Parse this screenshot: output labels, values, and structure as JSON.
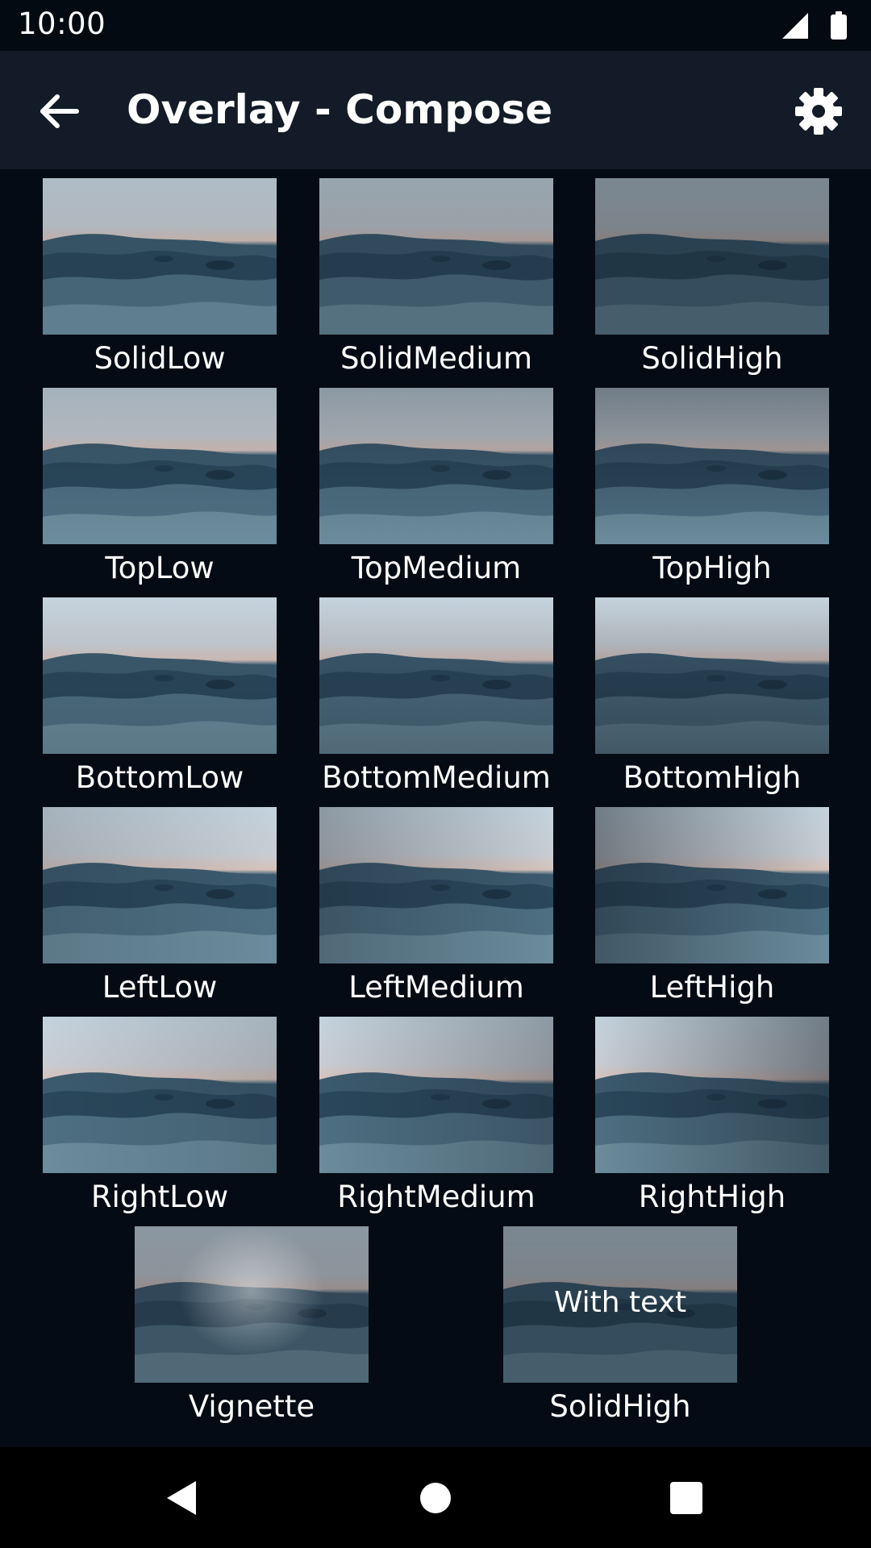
{
  "status_bar": {
    "time": "10:00"
  },
  "app_bar": {
    "title": "Overlay - Compose"
  },
  "grid": {
    "items": [
      {
        "label": "SolidLow",
        "overlay": "solid-low"
      },
      {
        "label": "SolidMedium",
        "overlay": "solid-medium"
      },
      {
        "label": "SolidHigh",
        "overlay": "solid-high"
      },
      {
        "label": "TopLow",
        "overlay": "top-low"
      },
      {
        "label": "TopMedium",
        "overlay": "top-medium"
      },
      {
        "label": "TopHigh",
        "overlay": "top-high"
      },
      {
        "label": "BottomLow",
        "overlay": "bottom-low"
      },
      {
        "label": "BottomMedium",
        "overlay": "bottom-medium"
      },
      {
        "label": "BottomHigh",
        "overlay": "bottom-high"
      },
      {
        "label": "LeftLow",
        "overlay": "left-low"
      },
      {
        "label": "LeftMedium",
        "overlay": "left-medium"
      },
      {
        "label": "LeftHigh",
        "overlay": "left-high"
      },
      {
        "label": "RightLow",
        "overlay": "right-low"
      },
      {
        "label": "RightMedium",
        "overlay": "right-medium"
      },
      {
        "label": "RightHigh",
        "overlay": "right-high"
      },
      {
        "label": "Vignette",
        "overlay": "vignette"
      },
      {
        "label": "SolidHigh",
        "overlay": "solid-high",
        "overlay_text": "With text"
      }
    ]
  },
  "icons": {
    "back": "arrow-back-icon",
    "settings": "gear-icon",
    "signal": "signal-icon",
    "battery": "battery-icon",
    "nav_back": "triangle-back-icon",
    "nav_home": "circle-home-icon",
    "nav_recents": "square-recents-icon"
  },
  "colors": {
    "background": "#050b14",
    "app_bar": "#121b27",
    "status_bar": "#040a12",
    "text": "#ffffff"
  }
}
